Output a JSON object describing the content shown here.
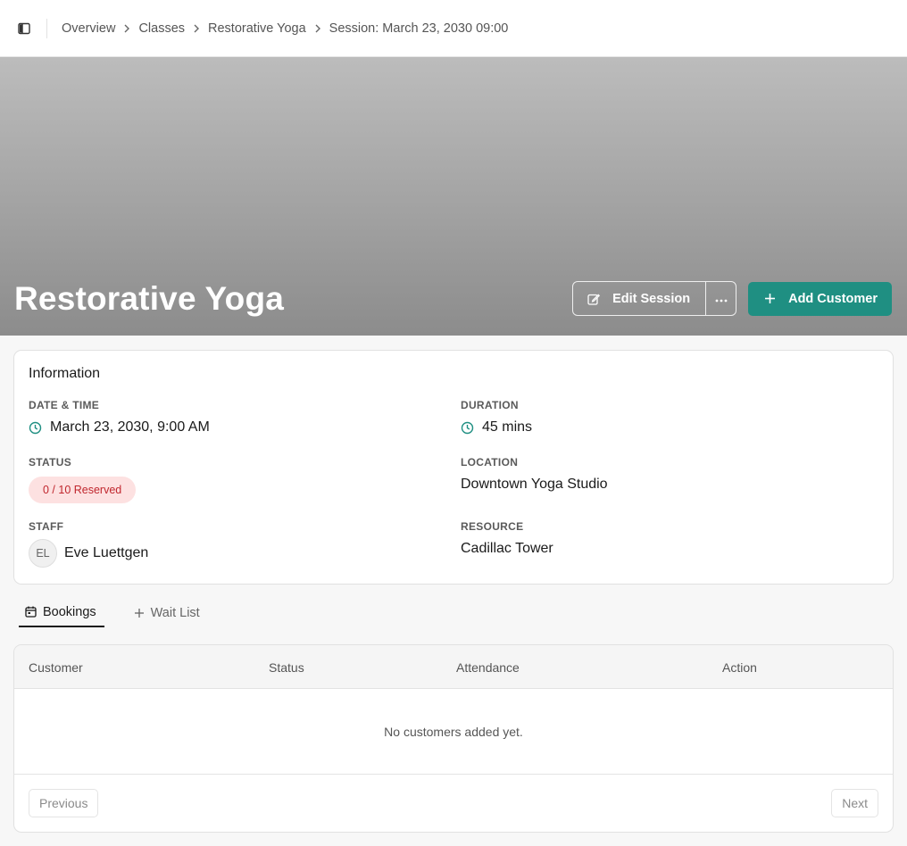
{
  "breadcrumb": {
    "items": [
      "Overview",
      "Classes",
      "Restorative Yoga",
      "Session: March 23, 2030 09:00"
    ]
  },
  "hero": {
    "title": "Restorative Yoga",
    "edit_label": "Edit Session",
    "add_label": "Add Customer"
  },
  "info": {
    "heading": "Information",
    "date_label": "DATE & TIME",
    "date_value": "March 23, 2030, 9:00 AM",
    "duration_label": "DURATION",
    "duration_value": "45 mins",
    "status_label": "STATUS",
    "status_value": "0 / 10 Reserved",
    "location_label": "LOCATION",
    "location_value": "Downtown Yoga Studio",
    "staff_label": "STAFF",
    "staff_initials": "EL",
    "staff_name": "Eve Luettgen",
    "resource_label": "RESOURCE",
    "resource_value": "Cadillac Tower"
  },
  "tabs": [
    {
      "label": "Bookings",
      "active": true
    },
    {
      "label": "Wait List",
      "active": false
    }
  ],
  "table": {
    "columns": [
      "Customer",
      "Status",
      "Attendance",
      "Action"
    ],
    "empty_message": "No customers added yet.",
    "previous_label": "Previous",
    "next_label": "Next"
  },
  "colors": {
    "accent": "#1f8f82",
    "badge_bg": "#fde1e1",
    "badge_text": "#c0262d"
  }
}
